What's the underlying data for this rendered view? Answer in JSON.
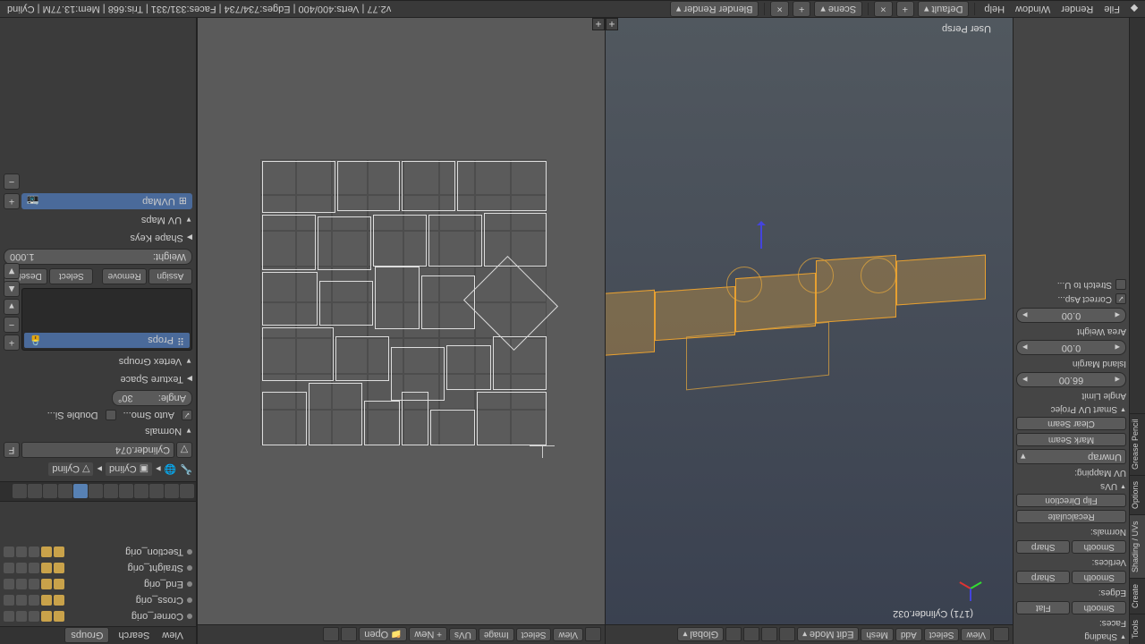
{
  "topbar": {
    "menus": [
      "File",
      "Render",
      "Window",
      "Help"
    ],
    "layout": "Default",
    "scene": "Scene",
    "engine": "Blender Render",
    "status": "v2.77 | Verts:400/400 | Edges:734/734 | Faces:331/331 | Tris:668 | Mem:13.77M | Cylind"
  },
  "view3d": {
    "header": {
      "menus": [
        "View",
        "Select",
        "Add",
        "Mesh"
      ],
      "mode": "Edit Mode",
      "orient": "Global"
    },
    "overlay_object": "(171) Cylinder.032",
    "persp": "User Persp"
  },
  "uv": {
    "header": {
      "menus": [
        "View",
        "Select",
        "Image",
        "UVs"
      ],
      "new": "New",
      "open": "Open"
    }
  },
  "toolshelf": {
    "tabs": [
      "Tools",
      "Create",
      "Shading / UVs",
      "Options",
      "Grease Pencil"
    ],
    "shading_panel": "Shading",
    "faces_lbl": "Faces:",
    "smooth": "Smooth",
    "flat": "Flat",
    "edges_lbl": "Edges:",
    "smooth2": "Smooth",
    "sharp": "Sharp",
    "verts_lbl": "Vertices:",
    "smooth3": "Smooth",
    "sharp2": "Sharp",
    "normals_lbl": "Normals:",
    "recalc": "Recalculate",
    "flip": "Flip Direction",
    "uvs_panel": "UVs",
    "uvmapping_lbl": "UV Mapping:",
    "unwrap": "Unwrap",
    "mark_seam": "Mark Seam",
    "clear_seam": "Clear Seam",
    "smart_panel": "Smart UV Projec",
    "angle_lbl": "Angle Limit",
    "angle_val": "66.00",
    "margin_lbl": "Island Margin",
    "margin_val": "0.00",
    "area_lbl": "Area Weight",
    "area_val": "0.00",
    "correct": "Correct Asp...",
    "stretch": "Stretch to U..."
  },
  "outliner": {
    "header": {
      "view": "View",
      "search": "Search",
      "groups": "Groups"
    },
    "items": [
      {
        "name": "Corner_orig"
      },
      {
        "name": "Cross_orig"
      },
      {
        "name": "End_orig"
      },
      {
        "name": "Straight_orig"
      },
      {
        "name": "Tsection_orig"
      }
    ]
  },
  "props": {
    "crumb1": "Cylind",
    "crumb2": "Cylind",
    "datablock": "Cylinder.074",
    "f": "F",
    "normals_panel": "Normals",
    "auto_smooth": "Auto Smo...",
    "double_sided": "Double Si...",
    "angle_lbl": "Angle:",
    "angle_val": "30°",
    "texspace_panel": "Texture Space",
    "vgroups_panel": "Vertex Groups",
    "vgroup_item": "Props",
    "assign": "Assign",
    "remove": "Remove",
    "select": "Select",
    "deselect": "Deselec",
    "weight_lbl": "Weight:",
    "weight_val": "1.000",
    "shapekeys_panel": "Shape Keys",
    "uvmaps_panel": "UV Maps",
    "uvmap_item": "UVMap"
  }
}
